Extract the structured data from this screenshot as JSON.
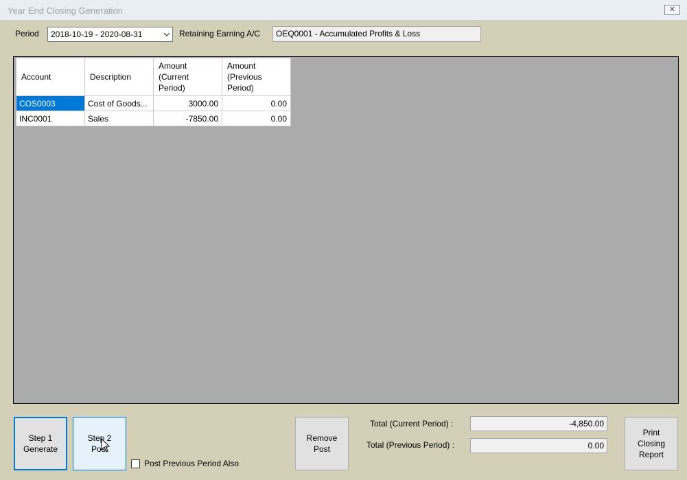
{
  "window": {
    "title": "Year End Closing Generation",
    "close_icon": "close-icon"
  },
  "filters": {
    "period_label": "Period",
    "period_value": "2018-10-19 - 2020-08-31",
    "retaining_label": "Retaining Earning A/C",
    "retaining_value": "OEQ0001 - Accumulated Profits & Loss"
  },
  "grid": {
    "columns": [
      "Account",
      "Description",
      "Amount (Current Period)",
      "Amount (Previous Period)"
    ],
    "rows": [
      {
        "account": "COS0003",
        "description": "Cost of Goods...",
        "current": "3000.00",
        "previous": "0.00",
        "selected": true
      },
      {
        "account": "INC0001",
        "description": "Sales",
        "current": "-7850.00",
        "previous": "0.00",
        "selected": false
      }
    ]
  },
  "actions": {
    "step1_line1": "Step 1",
    "step1_line2": "Generate",
    "step2_line1": "Step 2",
    "step2_line2": "Post",
    "post_previous_label": "Post Previous Period Also",
    "post_previous_checked": false,
    "remove_line1": "Remove",
    "remove_line2": "Post",
    "print_line1": "Print",
    "print_line2": "Closing",
    "print_line3": "Report"
  },
  "totals": {
    "current_label": "Total (Current Period) :",
    "current_value": "-4,850.00",
    "previous_label": "Total (Previous Period) :",
    "previous_value": "0.00"
  },
  "colors": {
    "background": "#d4d0b8",
    "selection": "#0078d7",
    "grid_empty": "#ababab"
  }
}
